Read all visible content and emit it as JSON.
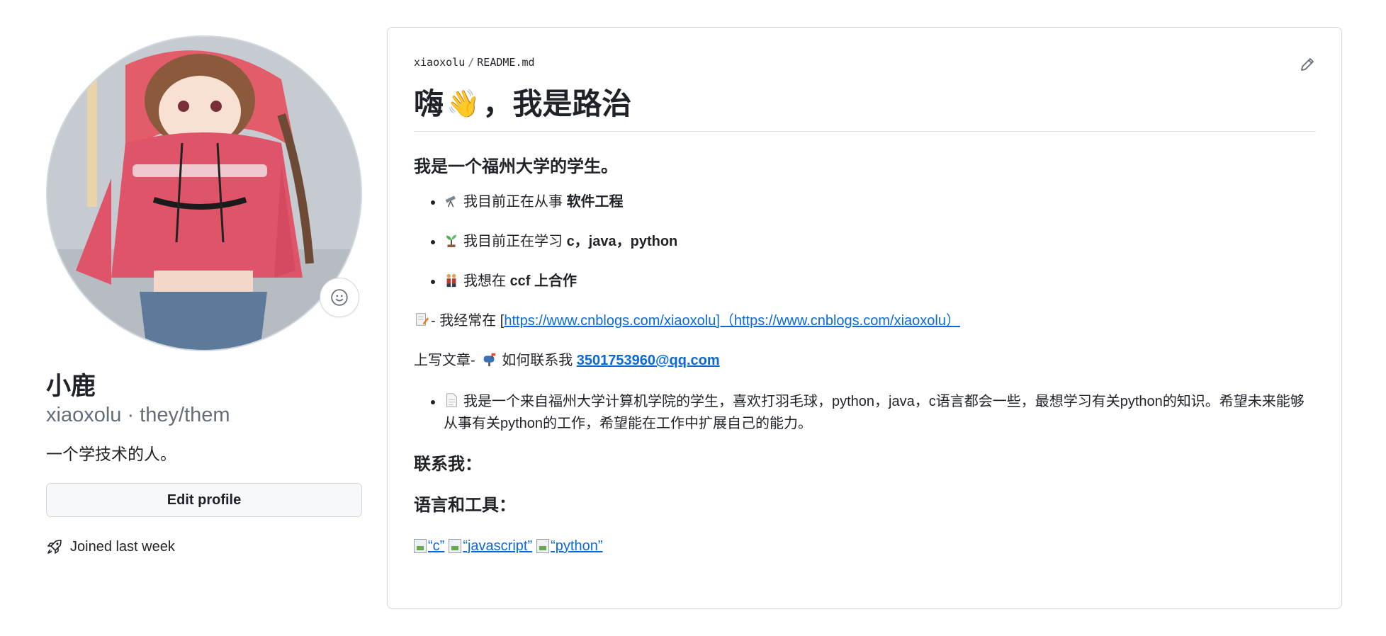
{
  "profile": {
    "display_name": "小鹿",
    "login_line": "xiaoxolu · they/them",
    "bio": "一个学技术的人。",
    "edit_button": "Edit profile",
    "joined": "Joined last week",
    "avatar_icon": "anime-avatar-image",
    "status_icon": "smiley-icon"
  },
  "readme": {
    "owner": "xiaoxolu",
    "separator": "/",
    "file": "README.md",
    "edit_icon": "pencil-icon",
    "title_text_a": "嗨",
    "title_emoji": "👋",
    "title_text_b": "，我是路治",
    "heading_intro": "我是一个福州大学的学生。",
    "bullets": [
      {
        "icon": "telescope",
        "text": "我目前正在从事 ",
        "bold": "软件工程"
      },
      {
        "icon": "seedling",
        "text": "我目前正在学习 ",
        "bold": "c，java，python"
      },
      {
        "icon": "people",
        "text": "我想在 ",
        "bold_a": "ccf",
        "bold": "上合作"
      }
    ],
    "write_prefix": "- 我经常在 [",
    "write_link": "https://www.cnblogs.com/xiaoxolu]（https://www.cnblogs.com/xiaoxolu）",
    "write_suffix": "上写文章-",
    "contact_label": "如何联系我",
    "contact_email": "3501753960@qq.com",
    "about_bullet": "我是一个来自福州大学计算机学院的学生，喜欢打羽毛球，python，java，c语言都会一些，最想学习有关python的知识。希望未来能够从事有关python的工作，希望能在工作中扩展自己的能力。",
    "heading_contact": "联系我：",
    "heading_tools": "语言和工具：",
    "badges": [
      "“c”",
      "“javascript”",
      "“python”"
    ]
  }
}
